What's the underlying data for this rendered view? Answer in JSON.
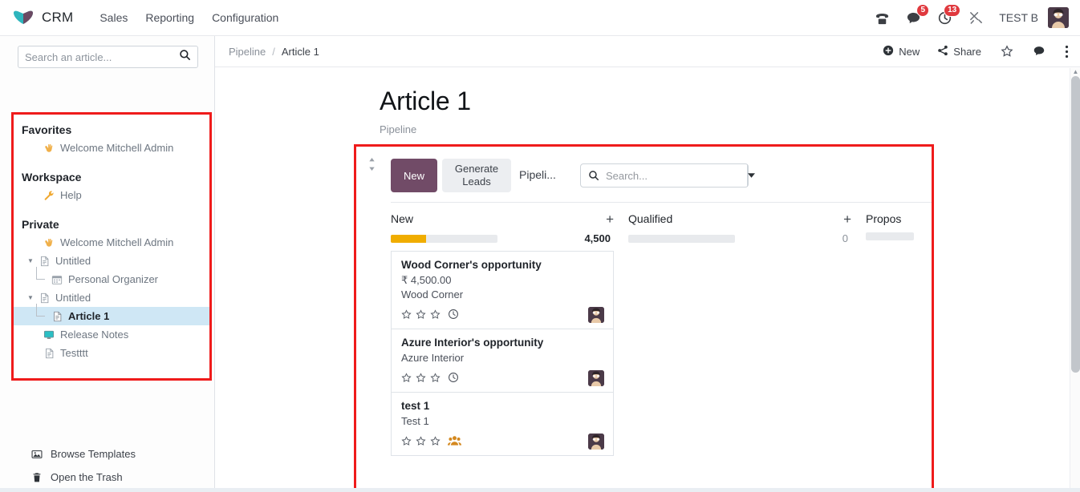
{
  "navbar": {
    "logo_icon": "odoo-logo-icon",
    "app_name": "CRM",
    "menus": [
      {
        "label": "Sales",
        "name": "nav-item-sales"
      },
      {
        "label": "Reporting",
        "name": "nav-item-reporting"
      },
      {
        "label": "Configuration",
        "name": "nav-item-configuration"
      }
    ],
    "sys_icons": [
      {
        "icon": "phone-icon",
        "badge": ""
      },
      {
        "icon": "chat-icon",
        "badge": "5"
      },
      {
        "icon": "activity-clock-icon",
        "badge": "13"
      },
      {
        "icon": "tools-icon",
        "badge": ""
      }
    ],
    "user_name": "TEST B",
    "avatar_icon": "user-avatar"
  },
  "sidebar": {
    "search": {
      "placeholder": "Search an article...",
      "value": "",
      "icon": "search-icon"
    },
    "sections": [
      {
        "title": "Favorites",
        "items": [
          {
            "label": "Welcome Mitchell Admin",
            "icon": "wave-emoji-icon",
            "indent": 1,
            "selected": false,
            "caret": ""
          }
        ]
      },
      {
        "title": "Workspace",
        "items": [
          {
            "label": "Help",
            "icon": "wrench-icon",
            "indent": 1,
            "selected": false,
            "caret": ""
          }
        ]
      },
      {
        "title": "Private",
        "items": [
          {
            "label": "Welcome Mitchell Admin",
            "icon": "wave-emoji-icon",
            "indent": 1,
            "selected": false,
            "caret": ""
          },
          {
            "label": "Untitled",
            "icon": "document-icon",
            "indent": 0,
            "selected": false,
            "caret": "caret-down-icon"
          },
          {
            "label": "Personal Organizer",
            "icon": "calendar-icon",
            "indent": 2,
            "selected": false,
            "caret": ""
          },
          {
            "label": "Untitled",
            "icon": "document-icon",
            "indent": 0,
            "selected": false,
            "caret": "caret-down-icon"
          },
          {
            "label": "Article 1",
            "icon": "document-icon",
            "indent": 2,
            "selected": true,
            "caret": ""
          },
          {
            "label": "Release Notes",
            "icon": "monitor-icon",
            "indent": 1,
            "selected": false,
            "caret": ""
          },
          {
            "label": "Testttt",
            "icon": "document-icon",
            "indent": 1,
            "selected": false,
            "caret": ""
          }
        ]
      }
    ],
    "footer": [
      {
        "label": "Browse Templates",
        "icon": "image-icon"
      },
      {
        "label": "Open the Trash",
        "icon": "trash-icon"
      }
    ]
  },
  "content_bar": {
    "breadcrumb": [
      "Pipeline",
      "Article 1"
    ],
    "separator": "/",
    "new_label": "New",
    "new_icon": "plus-circle-icon",
    "share_label": "Share",
    "share_icon": "share-nodes-icon",
    "star_icon": "star-outline-icon",
    "chat_icon": "comment-icon",
    "kebab_icon": "vertical-dots-icon"
  },
  "document": {
    "title": "Article 1",
    "subtitle": "Pipeline"
  },
  "embed": {
    "drag_handle_icon": "drag-updown-icon",
    "new_button": "New",
    "generate_button": "Generate Leads",
    "view_title": "Pipeli...",
    "search": {
      "placeholder": "Search...",
      "value": "",
      "icon": "search-icon",
      "dropdown_icon": "caret-down-icon"
    },
    "columns": [
      {
        "name": "New",
        "add_icon": "plus-icon",
        "total": "4,500",
        "progress_pct": 33,
        "progress_color": "#f0ad00",
        "cards": [
          {
            "title": "Wood Corner's opportunity",
            "amount": "₹ 4,500.00",
            "customer": "Wood Corner",
            "stars": 3,
            "stars_filled": 0,
            "tag_icon": "clock-icon",
            "tag_color": "#4a4f59",
            "avatar_icon": "user-avatar"
          },
          {
            "title": "Azure Interior's opportunity",
            "amount": "",
            "customer": "Azure Interior",
            "stars": 3,
            "stars_filled": 0,
            "tag_icon": "clock-icon",
            "tag_color": "#4a4f59",
            "avatar_icon": "user-avatar"
          },
          {
            "title": "test 1",
            "amount": "",
            "customer": "Test 1",
            "stars": 3,
            "stars_filled": 0,
            "tag_icon": "users-icon",
            "tag_color": "#e08a1e",
            "avatar_icon": "user-avatar"
          }
        ]
      },
      {
        "name": "Qualified",
        "add_icon": "plus-icon",
        "total": "0",
        "progress_pct": 0,
        "progress_color": "#f0ad00",
        "cards": []
      },
      {
        "name": "Propos",
        "add_icon": "",
        "total": "",
        "progress_pct": 0,
        "progress_color": "#f0ad00",
        "cards": []
      }
    ]
  },
  "annotations": {
    "highlight_color": "#ef1b1b",
    "regions": [
      "sidebar-article-tree",
      "embedded-kanban-view"
    ]
  }
}
